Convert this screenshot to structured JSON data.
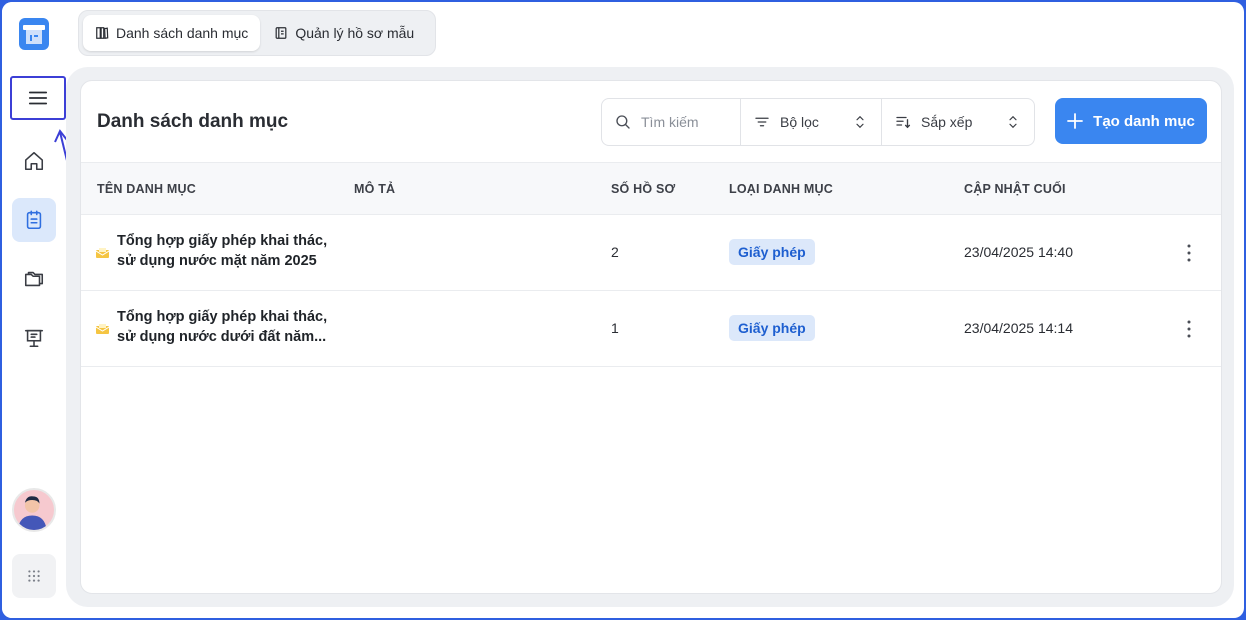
{
  "tabs": [
    {
      "label": "Danh sách danh mục",
      "icon": "book-icon",
      "selected": true
    },
    {
      "label": "Quản lý hồ sơ mẫu",
      "icon": "document-icon",
      "selected": false
    }
  ],
  "sidebar": {
    "items": [
      {
        "name": "menu",
        "icon": "hamburger-icon"
      },
      {
        "name": "home",
        "icon": "home-icon"
      },
      {
        "name": "catalog",
        "icon": "clipboard-icon",
        "active": true
      },
      {
        "name": "folders",
        "icon": "folder-icon"
      },
      {
        "name": "presentation",
        "icon": "presentation-icon"
      }
    ],
    "bottom": [
      {
        "icon": "avatar"
      },
      {
        "icon": "grid-dots-icon"
      }
    ]
  },
  "main": {
    "title": "Danh sách danh mục",
    "search_placeholder": "Tìm kiếm",
    "filter_label": "Bộ lọc",
    "sort_label": "Sắp xếp",
    "create_label": "Tạo danh mục"
  },
  "table": {
    "columns": [
      "TÊN DANH MỤC",
      "MÔ TẢ",
      "SỐ HỒ SƠ",
      "LOẠI DANH MỤC",
      "CẬP NHẬT CUỐI"
    ],
    "rows": [
      {
        "name": "Tổng hợp giấy phép khai thác, sử dụng nước mặt năm 2025",
        "description": "",
        "count": "2",
        "type": "Giấy phép",
        "updated": "23/04/2025 14:40"
      },
      {
        "name": "Tổng hợp giấy phép khai thác, sử dụng nước dưới đất năm...",
        "description": "",
        "count": "1",
        "type": "Giấy phép",
        "updated": "23/04/2025 14:14"
      }
    ]
  },
  "colors": {
    "accent": "#3a86f0",
    "badge_bg": "#dce8fa",
    "badge_text": "#1e5fd0",
    "highlight": "#3c3fd6"
  }
}
